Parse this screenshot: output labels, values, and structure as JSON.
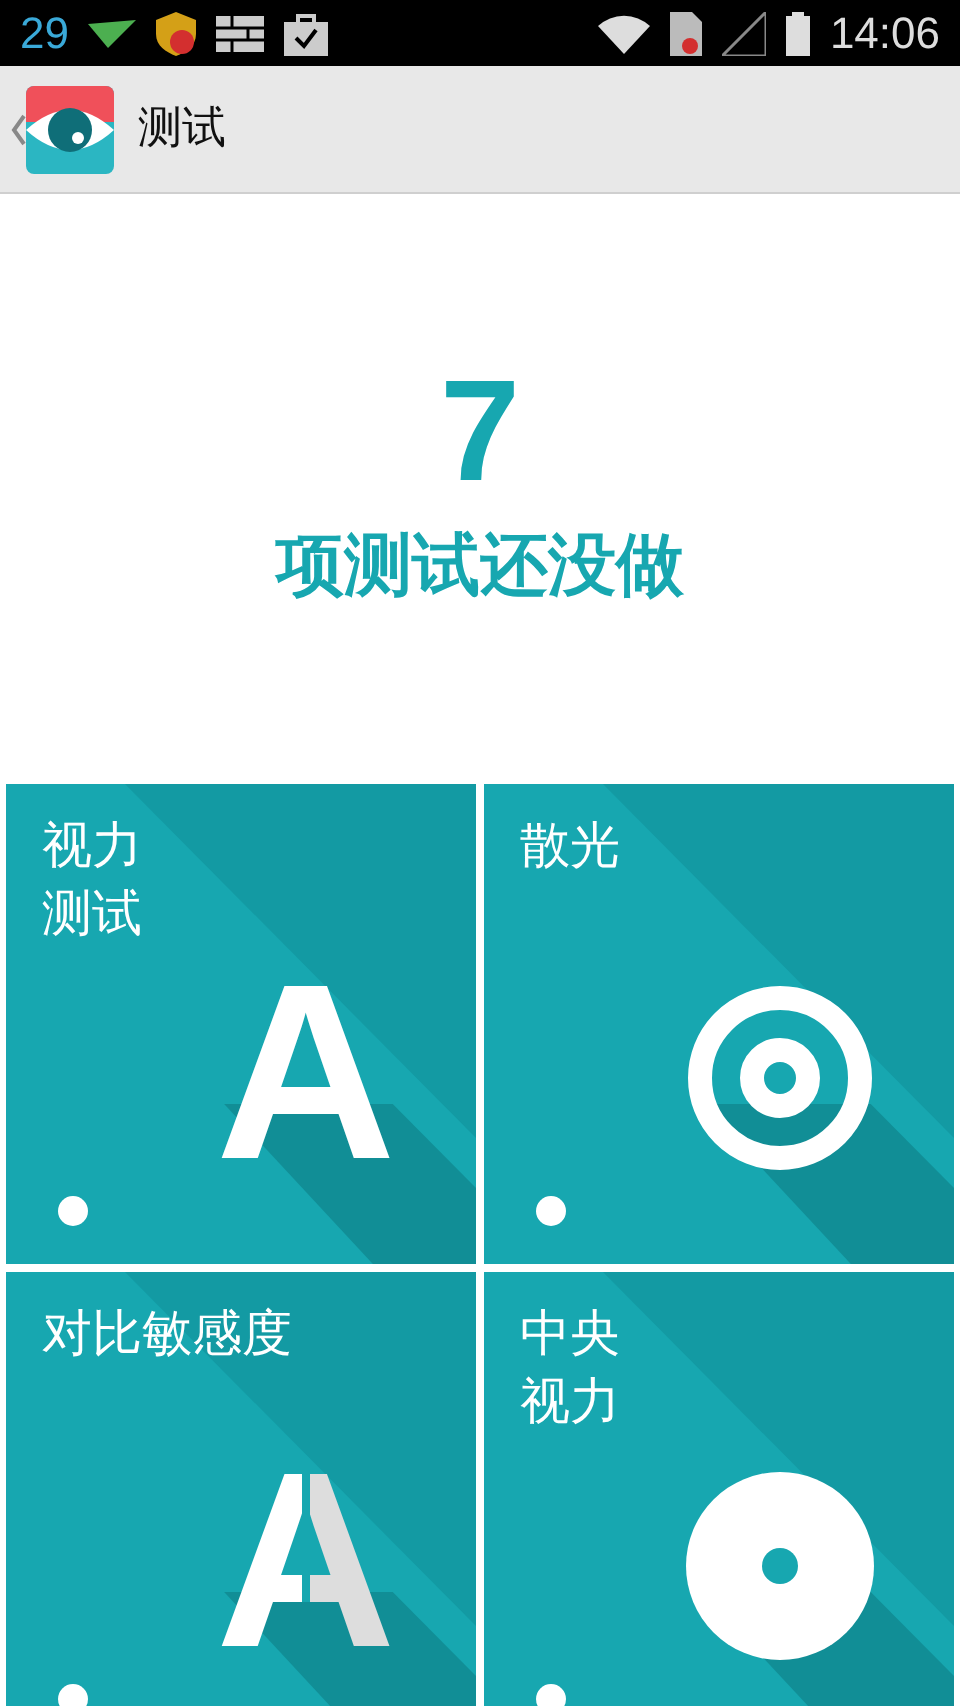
{
  "status_bar": {
    "notification_count": "29",
    "time": "14:06"
  },
  "app_bar": {
    "title": "测试"
  },
  "summary": {
    "count": "7",
    "caption": "项测试还没做"
  },
  "tiles": [
    {
      "label_lines": [
        "视力",
        "测试"
      ],
      "kind": "letter",
      "symbol": "A"
    },
    {
      "label_lines": [
        "散光"
      ],
      "kind": "rings"
    },
    {
      "label_lines": [
        "对比敏感度"
      ],
      "kind": "split_letter",
      "symbol": "A"
    },
    {
      "label_lines": [
        "中央",
        "视力"
      ],
      "kind": "disc"
    }
  ]
}
